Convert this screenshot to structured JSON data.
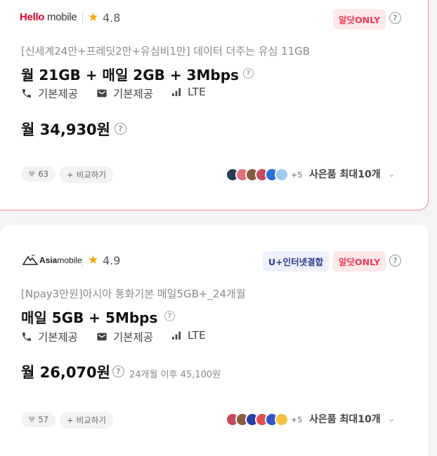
{
  "cards": [
    {
      "logo_primary": "Hello",
      "logo_secondary": " mobile",
      "rating": "4.8",
      "badges": [
        "알닷ONLY"
      ],
      "subtitle": "[신세계24만+프레딧2만+유심비1만] 데이터 더주는 유심 11GB",
      "plan_title": "월 21GB + 매일 2GB + 3Mbps",
      "features": {
        "call": "기본제공",
        "sms": "기본제공",
        "network": "LTE"
      },
      "price": "월 34,930원",
      "after_price": "",
      "likes": "63",
      "compare": "비교하기",
      "gift_more": "+5",
      "gift_label": "사은품 최대10개",
      "gift_colors": [
        "#2b3b5a",
        "#e0707a",
        "#8b5a3c",
        "#c44b5c",
        "#2a6fd6",
        "#9ec9f0"
      ]
    },
    {
      "logo_primary": "Asia",
      "logo_secondary": "mobile",
      "rating": "4.9",
      "badges": [
        "U+인터넷결합",
        "알닷ONLY"
      ],
      "subtitle": "[Npay3만원]아시아 통화기본 매일5GB+_24개월",
      "plan_title": "매일 5GB + 5Mbps",
      "features": {
        "call": "기본제공",
        "sms": "기본제공",
        "network": "LTE"
      },
      "price": "월 26,070원",
      "after_price": "24개월 이후 45,100원",
      "likes": "57",
      "compare": "비교하기",
      "gift_more": "+5",
      "gift_label": "사은품 최대10개",
      "gift_colors": [
        "#c44b5c",
        "#8b5a3c",
        "#2a3ea8",
        "#e05050",
        "#3355cc",
        "#f0c040"
      ]
    }
  ],
  "colors": {
    "accent_pink": "#ef3b55",
    "star": "#f5a800",
    "border_highlight": "#f08a8a"
  }
}
